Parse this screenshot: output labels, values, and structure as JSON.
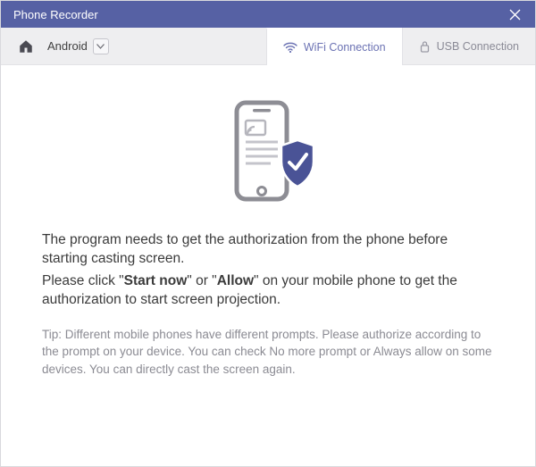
{
  "titlebar": {
    "title": "Phone Recorder"
  },
  "toolbar": {
    "platform_dropdown_label": "Android",
    "tabs": {
      "wifi": {
        "label": "WiFi Connection"
      },
      "usb": {
        "label": "USB Connection"
      }
    }
  },
  "content": {
    "line1": "The program needs to get the authorization from the phone before starting casting screen.",
    "line2_pre": "Please click \"",
    "line2_bold1": "Start now",
    "line2_mid": "\" or \"",
    "line2_bold2": "Allow",
    "line2_post": "\" on your mobile phone to get the authorization to start screen projection.",
    "tip": "Tip: Different mobile phones have different prompts. Please authorize according to the prompt on your device. You can check No more prompt or Always allow on some devices. You can directly cast the screen again."
  },
  "icons": {
    "home": "home-icon",
    "wifi": "wifi-icon",
    "usb": "usb-lock-icon",
    "close": "close-icon",
    "chevron": "chevron-down-icon",
    "phone_shield": "phone-shield-icon"
  }
}
